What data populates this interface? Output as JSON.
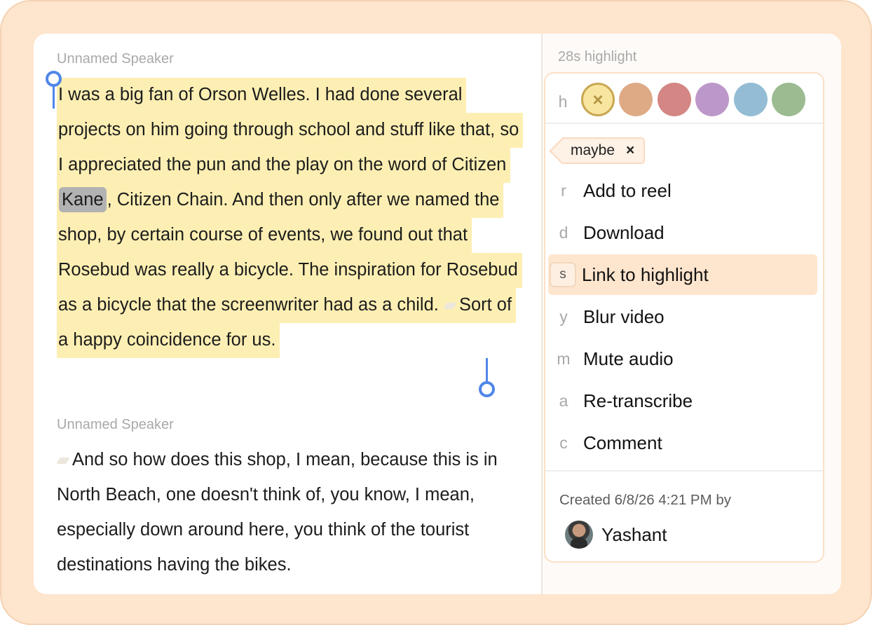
{
  "transcript": {
    "segments": [
      {
        "speaker": "Unnamed Speaker",
        "text_before": "I was a big fan of Orson Welles. I had done several projects on him going through school and stuff like that, so I appreciated the pun and the play on the word of Citizen ",
        "highlight_word": "Kane",
        "text_after": ", Citizen Chain. And then only after we named the shop, by certain course of events, we found out that Rosebud was really a bicycle. The inspiration for Rosebud as a bicycle that the screenwriter had as a child. ",
        "text_end": "Sort of a happy coincidence for us."
      },
      {
        "speaker": "Unnamed Speaker",
        "text": "And so how does this shop, I mean, because this is in North Beach, one doesn't think of, you know, I mean, especially down around here, you think of the tourist destinations having the bikes."
      }
    ]
  },
  "panel": {
    "title": "28s highlight",
    "color_key": "h",
    "colors": [
      {
        "hex": "#f8e6a0",
        "selected": true,
        "label": "×"
      },
      {
        "hex": "#deaa86"
      },
      {
        "hex": "#d38683"
      },
      {
        "hex": "#bc97c9"
      },
      {
        "hex": "#94bdd5"
      },
      {
        "hex": "#9cbb91"
      }
    ],
    "tag": {
      "label": "maybe",
      "remove": "×"
    },
    "items": [
      {
        "key": "r",
        "label": "Add to reel"
      },
      {
        "key": "d",
        "label": "Download"
      },
      {
        "key": "s",
        "label": "Link to highlight",
        "active": true
      },
      {
        "key": "y",
        "label": "Blur video"
      },
      {
        "key": "m",
        "label": "Mute audio"
      },
      {
        "key": "a",
        "label": "Re-transcribe"
      },
      {
        "key": "c",
        "label": "Comment"
      }
    ],
    "created": "Created 6/8/26 4:21 PM by",
    "user": "Yashant"
  },
  "colors": {
    "frame_bg": "#fee5cd",
    "highlight_bg": "#fdefb3",
    "selection_handle": "#4f86e8",
    "active_item_bg": "#fee5cd"
  }
}
